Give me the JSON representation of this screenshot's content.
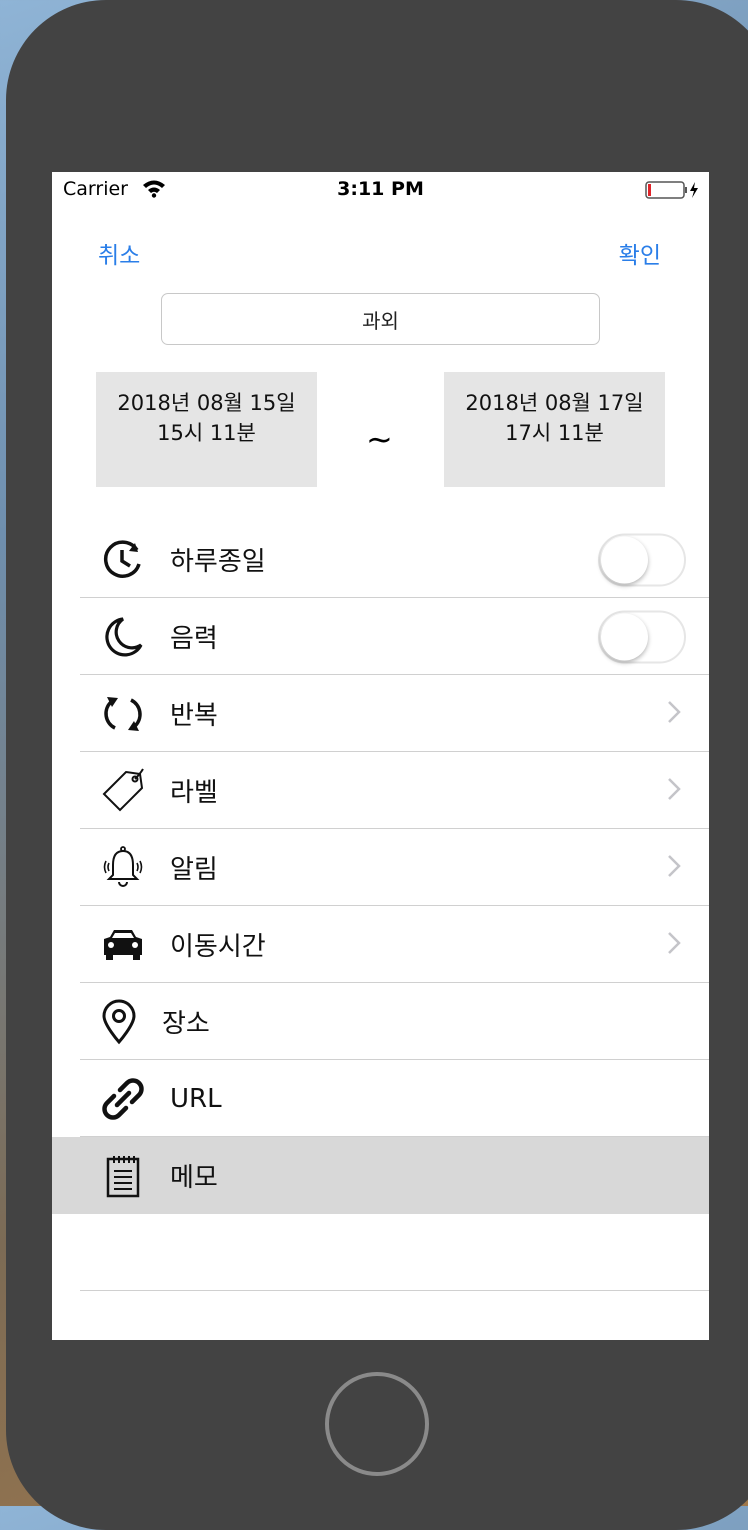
{
  "status_bar": {
    "carrier": "Carrier",
    "time": "3:11 PM",
    "icons": [
      "wifi-icon",
      "battery-icon",
      "charging-bolt-icon"
    ]
  },
  "nav": {
    "cancel_label": "취소",
    "confirm_label": "확인",
    "accent_color": "#2a7ee8"
  },
  "title_field": {
    "value": "과외"
  },
  "date_range": {
    "start": {
      "date": "2018년 08월 15일",
      "time": "15시 11분"
    },
    "separator": "~",
    "end": {
      "date": "2018년 08월 17일",
      "time": "17시 11분"
    }
  },
  "options": [
    {
      "icon": "clock-icon",
      "label": "하루종일",
      "control": "toggle",
      "on": false
    },
    {
      "icon": "moon-icon",
      "label": "음력",
      "control": "toggle",
      "on": false
    },
    {
      "icon": "repeat-icon",
      "label": "반복",
      "control": "chevron"
    },
    {
      "icon": "tag-icon",
      "label": "라벨",
      "control": "chevron"
    },
    {
      "icon": "bell-icon",
      "label": "알림",
      "control": "chevron"
    },
    {
      "icon": "car-icon",
      "label": "이동시간",
      "control": "chevron"
    },
    {
      "icon": "location-pin-icon",
      "label": "장소",
      "control": "none"
    },
    {
      "icon": "link-icon",
      "label": "URL",
      "control": "none"
    },
    {
      "icon": "notepad-icon",
      "label": "메모",
      "control": "none",
      "selected": true
    }
  ]
}
